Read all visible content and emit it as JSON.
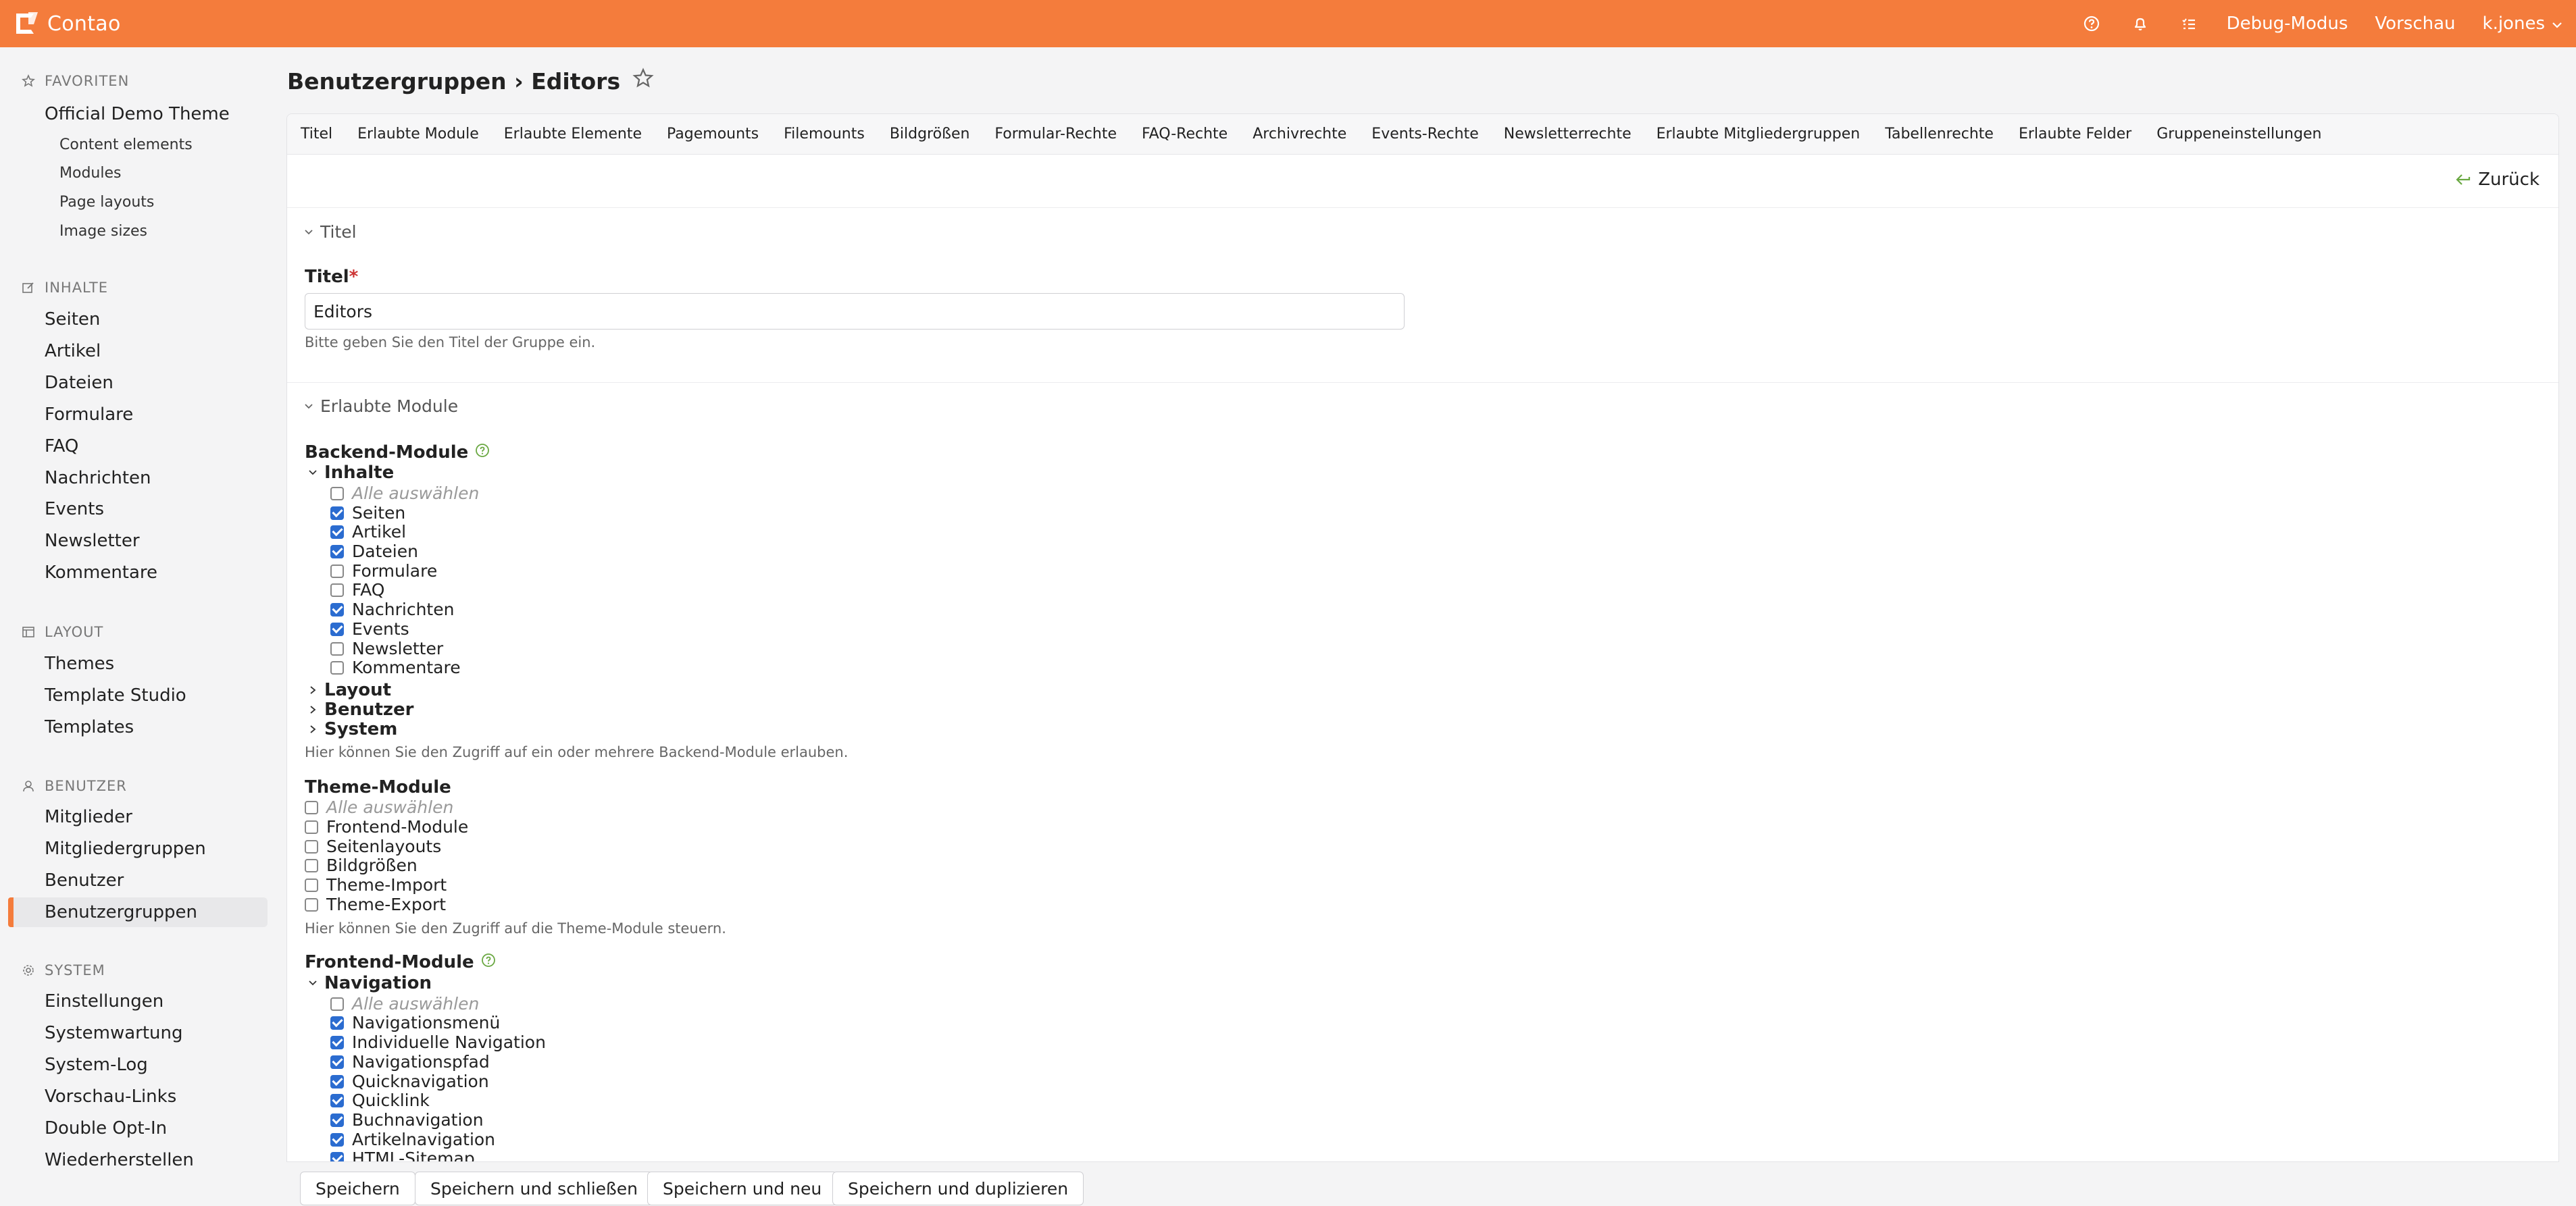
{
  "app": {
    "name": "Contao",
    "brand_color": "#f47c3c"
  },
  "topbar": {
    "icons": [
      "help-icon",
      "bell-icon",
      "tasks-icon"
    ],
    "debug_label": "Debug-Modus",
    "preview_label": "Vorschau",
    "user_label": "k.jones"
  },
  "sidebar": {
    "groups": [
      {
        "title": "FAVORITEN",
        "icon": "star-icon",
        "items": [
          "Official Demo Theme"
        ],
        "subitems": [
          "Content elements",
          "Modules",
          "Page layouts",
          "Image sizes"
        ]
      },
      {
        "title": "INHALTE",
        "icon": "edit-icon",
        "items": [
          "Seiten",
          "Artikel",
          "Dateien",
          "Formulare",
          "FAQ",
          "Nachrichten",
          "Events",
          "Newsletter",
          "Kommentare"
        ]
      },
      {
        "title": "LAYOUT",
        "icon": "layout-icon",
        "items": [
          "Themes",
          "Template Studio",
          "Templates"
        ]
      },
      {
        "title": "BENUTZER",
        "icon": "user-icon",
        "items": [
          "Mitglieder",
          "Mitgliedergruppen",
          "Benutzer",
          "Benutzergruppen"
        ]
      },
      {
        "title": "SYSTEM",
        "icon": "gear-icon",
        "items": [
          "Einstellungen",
          "Systemwartung",
          "System-Log",
          "Vorschau-Links",
          "Double Opt-In",
          "Wiederherstellen"
        ]
      }
    ],
    "active_item": "Benutzergruppen"
  },
  "page": {
    "title": "Benutzergruppen › Editors"
  },
  "tabs": [
    "Titel",
    "Erlaubte Module",
    "Erlaubte Elemente",
    "Pagemounts",
    "Filemounts",
    "Bildgrößen",
    "Formular-Rechte",
    "FAQ-Rechte",
    "Archivrechte",
    "Events-Rechte",
    "Newsletterrechte",
    "Erlaubte Mitgliedergruppen",
    "Tabellenrechte",
    "Erlaubte Felder",
    "Gruppeneinstellungen"
  ],
  "back_label": "Zurück",
  "section_title": {
    "legend": "Titel",
    "label": "Titel",
    "required_mark": "*",
    "value": "Editors",
    "hint": "Bitte geben Sie den Titel der Gruppe ein."
  },
  "section_modules": {
    "legend": "Erlaubte Module",
    "backend": {
      "label": "Backend-Module",
      "group_open": "Inhalte",
      "select_all": "Alle auswählen",
      "items": [
        {
          "label": "Seiten",
          "checked": true
        },
        {
          "label": "Artikel",
          "checked": true
        },
        {
          "label": "Dateien",
          "checked": true
        },
        {
          "label": "Formulare",
          "checked": false
        },
        {
          "label": "FAQ",
          "checked": false
        },
        {
          "label": "Nachrichten",
          "checked": true
        },
        {
          "label": "Events",
          "checked": true
        },
        {
          "label": "Newsletter",
          "checked": false
        },
        {
          "label": "Kommentare",
          "checked": false
        }
      ],
      "collapsed_groups": [
        "Layout",
        "Benutzer",
        "System"
      ],
      "hint": "Hier können Sie den Zugriff auf ein oder mehrere Backend-Module erlauben."
    },
    "theme": {
      "label": "Theme-Module",
      "select_all": "Alle auswählen",
      "items": [
        {
          "label": "Frontend-Module",
          "checked": false
        },
        {
          "label": "Seitenlayouts",
          "checked": false
        },
        {
          "label": "Bildgrößen",
          "checked": false
        },
        {
          "label": "Theme-Import",
          "checked": false
        },
        {
          "label": "Theme-Export",
          "checked": false
        }
      ],
      "hint": "Hier können Sie den Zugriff auf die Theme-Module steuern."
    },
    "frontend": {
      "label": "Frontend-Module",
      "group_open": "Navigation",
      "select_all": "Alle auswählen",
      "items": [
        {
          "label": "Navigationsmenü",
          "checked": true
        },
        {
          "label": "Individuelle Navigation",
          "checked": true
        },
        {
          "label": "Navigationspfad",
          "checked": true
        },
        {
          "label": "Quicknavigation",
          "checked": true
        },
        {
          "label": "Quicklink",
          "checked": true
        },
        {
          "label": "Buchnavigation",
          "checked": true
        },
        {
          "label": "Artikelnavigation",
          "checked": true
        },
        {
          "label": "HTML-Sitemap",
          "checked": true
        }
      ]
    }
  },
  "buttons": [
    "Speichern",
    "Speichern und schließen",
    "Speichern und neu",
    "Speichern und duplizieren"
  ]
}
